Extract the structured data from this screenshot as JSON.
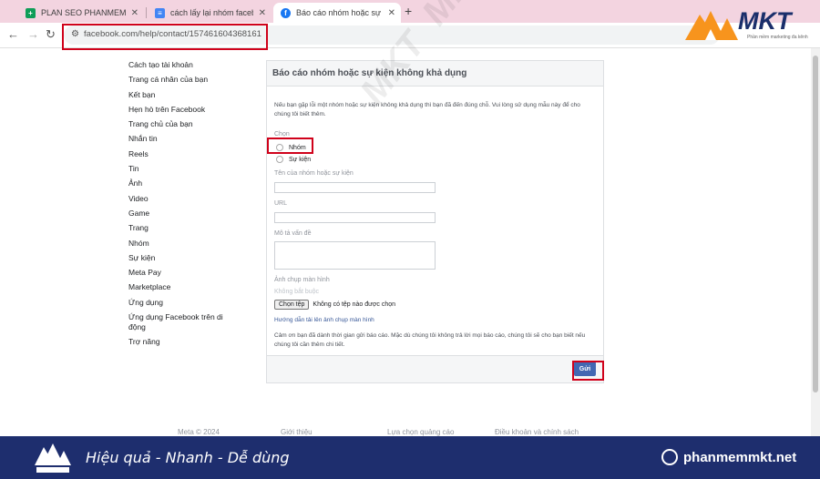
{
  "browser": {
    "tabs": [
      {
        "title": "PLAN SEO PHANMEMMKT.NET",
        "favicon_color": "#0f9d58",
        "active": false
      },
      {
        "title": "cách lấy lại nhóm facebook bị x",
        "favicon_color": "#4285f4",
        "active": false
      },
      {
        "title": "Báo cáo nhóm hoặc sự kiện khô",
        "favicon_color": "#1877f2",
        "active": true
      }
    ],
    "new_tab": "+",
    "url": "facebook.com/help/contact/157461604368161"
  },
  "brand": {
    "logo_text": "MKT",
    "tagline": "Phần mềm marketing đa kênh",
    "accent_orange": "#f7941d",
    "navy": "#1e2e6e"
  },
  "sidebar": {
    "items": [
      "Cách tạo tài khoản",
      "Trang cá nhân của bạn",
      "Kết bạn",
      "Hẹn hò trên Facebook",
      "Trang chủ của bạn",
      "Nhắn tin",
      "Reels",
      "Tin",
      "Ảnh",
      "Video",
      "Game",
      "Trang",
      "Nhóm",
      "Sự kiện",
      "Meta Pay",
      "Marketplace",
      "Ứng dụng",
      "Ứng dụng Facebook trên di động",
      "Trợ năng"
    ]
  },
  "form": {
    "title": "Báo cáo nhóm hoặc sự kiện không khả dụng",
    "intro": "Nếu bạn gặp lỗi một nhóm hoặc sự kiện không khả dụng thì bạn đã đến đúng chỗ. Vui lòng sử dụng mẫu này để cho chúng tôi biết thêm.",
    "choose_label": "Chọn",
    "options": [
      "Nhóm",
      "Sự kiện"
    ],
    "name_label": "Tên của nhóm hoặc sự kiện",
    "url_label": "URL",
    "desc_label": "Mô tả vấn đề",
    "screenshot_label": "Ảnh chụp màn hình",
    "optional": "Không bắt buộc",
    "file_button": "Chọn tệp",
    "file_status": "Không có tệp nào được chọn",
    "upload_help": "Hướng dẫn tải lên ảnh chụp màn hình",
    "thanks": "Cảm ơn bạn đã dành thời gian gửi báo cáo. Mặc dù chúng tôi không trả lời mọi báo cáo, chúng tôi sẽ cho bạn biết nếu chúng tôi cần thêm chi tiết.",
    "submit": "Gửi"
  },
  "page_footer": {
    "items": [
      "Meta © 2024",
      "Giới thiệu",
      "Lựa chọn quảng cáo",
      "Điều khoản và chính sách"
    ]
  },
  "watermark": {
    "text": "MKT"
  },
  "banner": {
    "slogan": "Hiệu quả - Nhanh - Dễ dùng",
    "site": "phanmemmkt.net"
  }
}
